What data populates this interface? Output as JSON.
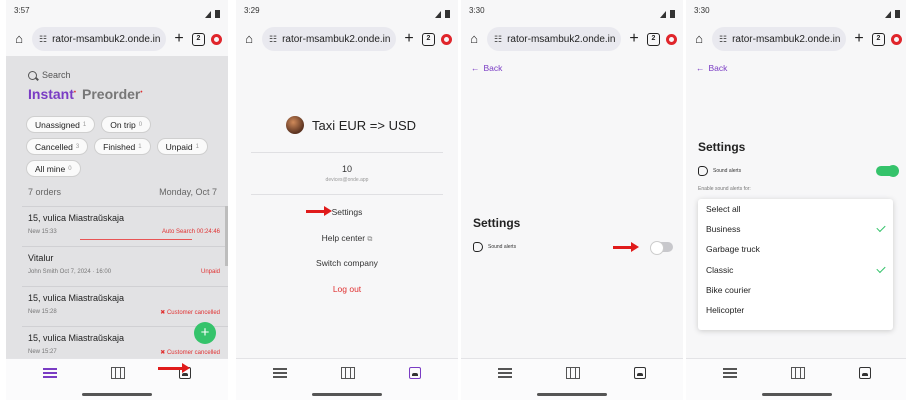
{
  "browser": {
    "url": "rator-msambuk2.onde.in",
    "tab_count": "2"
  },
  "panels": {
    "p1": {
      "time": "3:57"
    },
    "p2": {
      "time": "3:29"
    },
    "p3": {
      "time": "3:30"
    },
    "p4": {
      "time": "3:30"
    }
  },
  "orders_screen": {
    "search_placeholder": "Search",
    "modes": [
      "Instant",
      "Preorder"
    ],
    "filters": [
      {
        "label": "Unassigned",
        "count": "1"
      },
      {
        "label": "On trip",
        "count": "0"
      },
      {
        "label": "Cancelled",
        "count": "3"
      },
      {
        "label": "Finished",
        "count": "1"
      },
      {
        "label": "Unpaid",
        "count": "1"
      },
      {
        "label": "All mine",
        "count": "0"
      }
    ],
    "orders_count": "7 orders",
    "date": "Monday, Oct 7",
    "orders": [
      {
        "title": "15, vulica Miastraŭskaja",
        "meta": "New  15:33",
        "status": "Auto Search 00:24:46"
      },
      {
        "title": "Vitalur",
        "meta": "John Smith  Oct 7, 2024 · 16:00",
        "status": "Unpaid"
      },
      {
        "title": "15, vulica Miastraŭskaja",
        "meta": "New  15:28",
        "status": "✖ Customer cancelled"
      },
      {
        "title": "15, vulica Miastraŭskaja",
        "meta": "New  15:27",
        "status": "✖ Customer cancelled"
      }
    ]
  },
  "profile_screen": {
    "company": "Taxi EUR => USD",
    "account_number": "10",
    "account_email": "devices@onde.app",
    "menu": {
      "settings": "Settings",
      "help": "Help center",
      "help_icon": "⧉",
      "switch": "Switch company",
      "logout": "Log out"
    }
  },
  "settings_screen": {
    "back": "Back",
    "title": "Settings",
    "sound_alerts": "Sound alerts",
    "enable_for": "Enable sound alerts for:",
    "options": [
      {
        "label": "Select all",
        "checked": false
      },
      {
        "label": "Business",
        "checked": true
      },
      {
        "label": "Garbage truck",
        "checked": false
      },
      {
        "label": "Classic",
        "checked": true
      },
      {
        "label": "Bike courier",
        "checked": false
      },
      {
        "label": "Helicopter",
        "checked": false
      }
    ]
  },
  "colors": {
    "accent": "#7a3cc4",
    "success": "#35c36b",
    "danger": "#e03131",
    "arrow": "#e01b1b"
  }
}
